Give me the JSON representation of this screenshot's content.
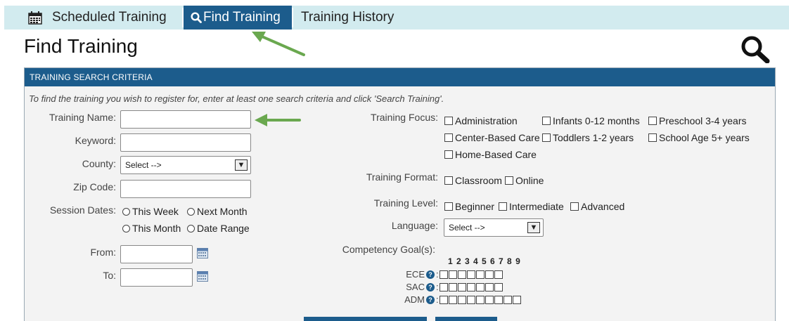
{
  "nav": {
    "scheduled": "Scheduled Training",
    "find": "Find Training",
    "history": "Training History"
  },
  "page_title": "Find Training",
  "panel": {
    "header": "TRAINING SEARCH CRITERIA",
    "instructions": "To find the training you wish to register for, enter at least one search criteria and click 'Search Training'."
  },
  "form": {
    "training_name_label": "Training Name:",
    "keyword_label": "Keyword:",
    "county_label": "County:",
    "county_value": "Select -->",
    "zip_label": "Zip Code:",
    "session_dates_label": "Session Dates:",
    "session_options": [
      "This Week",
      "Next Month",
      "This Month",
      "Date Range"
    ],
    "from_label": "From:",
    "to_label": "To:",
    "training_focus_label": "Training Focus:",
    "focus_options": [
      "Administration",
      "Infants 0-12 months",
      "Preschool 3-4 years",
      "Center-Based Care",
      "Toddlers 1-2 years",
      "School Age 5+ years",
      "Home-Based Care"
    ],
    "training_format_label": "Training Format:",
    "format_options": [
      "Classroom",
      "Online"
    ],
    "training_level_label": "Training Level:",
    "level_options": [
      "Beginner",
      "Intermediate",
      "Advanced"
    ],
    "language_label": "Language:",
    "language_value": "Select -->",
    "competency_label": "Competency Goal(s):",
    "competency_numbers": "1 2 3 4 5 6 7 8 9",
    "competency_rows": [
      {
        "label": "ECE",
        "count": 7
      },
      {
        "label": "SAC",
        "count": 7
      },
      {
        "label": "ADM",
        "count": 9
      }
    ]
  },
  "icons": {
    "calendar": "calendar-icon",
    "search": "search-icon",
    "help": "help-icon",
    "arrow": "arrow-icon"
  },
  "colors": {
    "nav_bg": "#d2ebef",
    "accent": "#1c5c8c",
    "arrow": "#6aa84f"
  }
}
